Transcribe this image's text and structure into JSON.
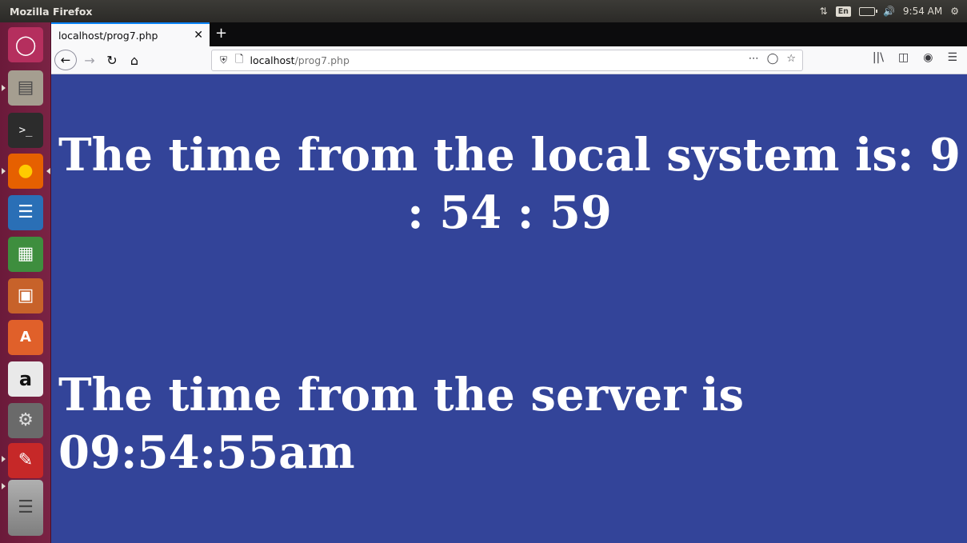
{
  "window": {
    "title": "Mozilla Firefox"
  },
  "tray": {
    "lang": "En",
    "clock": "9:54 AM"
  },
  "launcher": {
    "items": [
      {
        "name": "dash-icon"
      },
      {
        "name": "files-icon"
      },
      {
        "name": "terminal-icon"
      },
      {
        "name": "firefox-icon"
      },
      {
        "name": "writer-icon"
      },
      {
        "name": "calc-icon"
      },
      {
        "name": "impress-icon"
      },
      {
        "name": "software-center-icon"
      },
      {
        "name": "amazon-icon"
      },
      {
        "name": "system-settings-icon"
      },
      {
        "name": "document-viewer-icon"
      },
      {
        "name": "workspace-switcher-icon"
      }
    ]
  },
  "browser": {
    "tab_title": "localhost/prog7.php",
    "url_host": "localhost",
    "url_path": "/prog7.php"
  },
  "page": {
    "local_time": "The time from the local system is: 9 : 54 : 59",
    "server_time": "The time from the server is 09:54:55am"
  },
  "colors": {
    "page_background": "#334499",
    "text": "#ffffff",
    "launcher": "#6b1a3a"
  }
}
